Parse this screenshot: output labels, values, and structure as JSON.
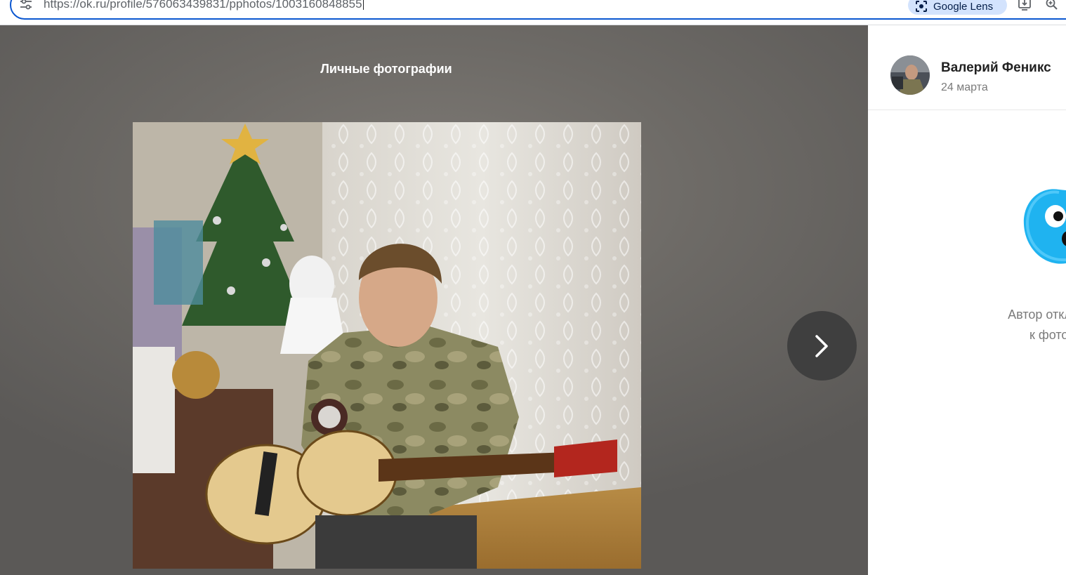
{
  "browser": {
    "url": "https://ok.ru/profile/576063439831/pphotos/1003160848855",
    "lens_label": "Google Lens",
    "site_icon": "tune-icon",
    "icons": [
      "google-lens-icon",
      "install-app-icon",
      "zoom-icon"
    ],
    "accent_color": "#0b57d0"
  },
  "viewer": {
    "album_title": "Личные фотографии",
    "next_icon": "chevron-right-icon",
    "background_color": "#6d6a66"
  },
  "side_panel": {
    "author_name": "Валерий Феникс",
    "date": "24 марта",
    "mascot_icon": "ok-mascot-icon",
    "comments_disabled_line1": "Автор отключил",
    "comments_disabled_line2": "к фотогр"
  }
}
